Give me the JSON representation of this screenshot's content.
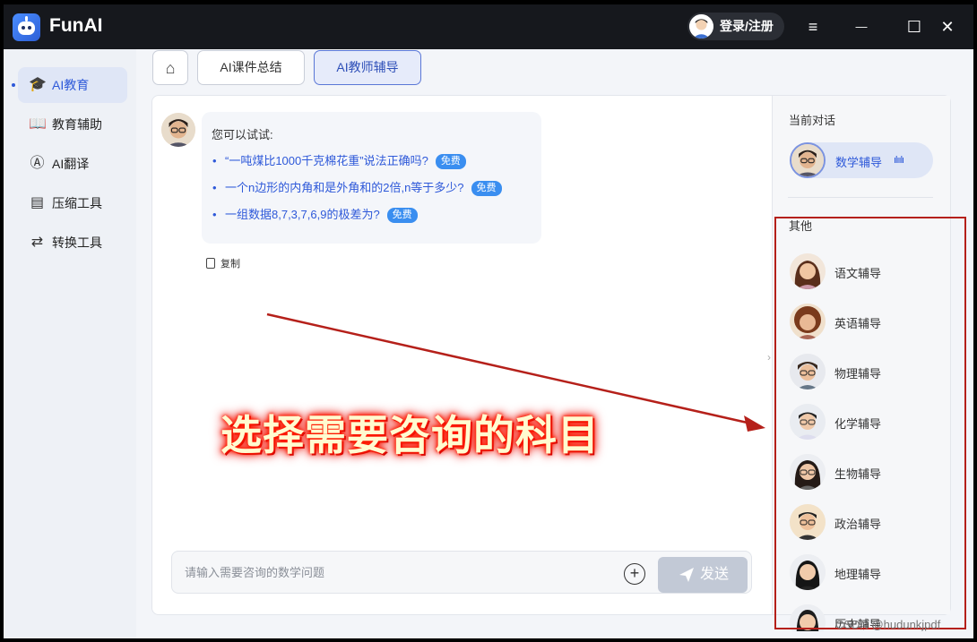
{
  "app": {
    "name": "FunAI",
    "login_label": "登录/注册"
  },
  "window_controls": {
    "menu": "≡",
    "minimize": "—",
    "maximize": "☐",
    "close": "✕"
  },
  "sidebar": {
    "items": [
      {
        "label": "AI教育",
        "icon": "graduation-cap-icon",
        "active": true
      },
      {
        "label": "教育辅助",
        "icon": "book-icon"
      },
      {
        "label": "AI翻译",
        "icon": "translate-icon"
      },
      {
        "label": "压缩工具",
        "icon": "compress-icon"
      },
      {
        "label": "转换工具",
        "icon": "convert-icon"
      }
    ]
  },
  "tabs": [
    {
      "label": "AI课件总结"
    },
    {
      "label": "AI教师辅导",
      "active": true
    }
  ],
  "chat": {
    "intro": "您可以试试:",
    "suggestions": [
      {
        "text": "“一吨煤比1000千克棉花重”说法正确吗?",
        "badge": "免费"
      },
      {
        "text": "一个n边形的内角和是外角和的2倍,n等于多少?",
        "badge": "免费"
      },
      {
        "text": "一组数据8,7,3,7,6,9的极差为?",
        "badge": "免费"
      }
    ],
    "copy_label": "复制",
    "input_placeholder": "请输入需要咨询的数学问题",
    "send_label": "发送"
  },
  "right_panel": {
    "current_label": "当前对话",
    "current_tutor": "数学辅导",
    "other_label": "其他",
    "tutors": [
      "语文辅导",
      "英语辅导",
      "物理辅导",
      "化学辅导",
      "生物辅导",
      "政治辅导",
      "地理辅导",
      "历史辅导"
    ]
  },
  "annotation": {
    "text": "选择需要咨询的科目",
    "color": "#b5201a"
  },
  "watermark": "CSDN @hudunkjpdf",
  "colors": {
    "accent": "#2e59d9",
    "badge": "#3a8ef0",
    "titlebar": "#16181d"
  }
}
